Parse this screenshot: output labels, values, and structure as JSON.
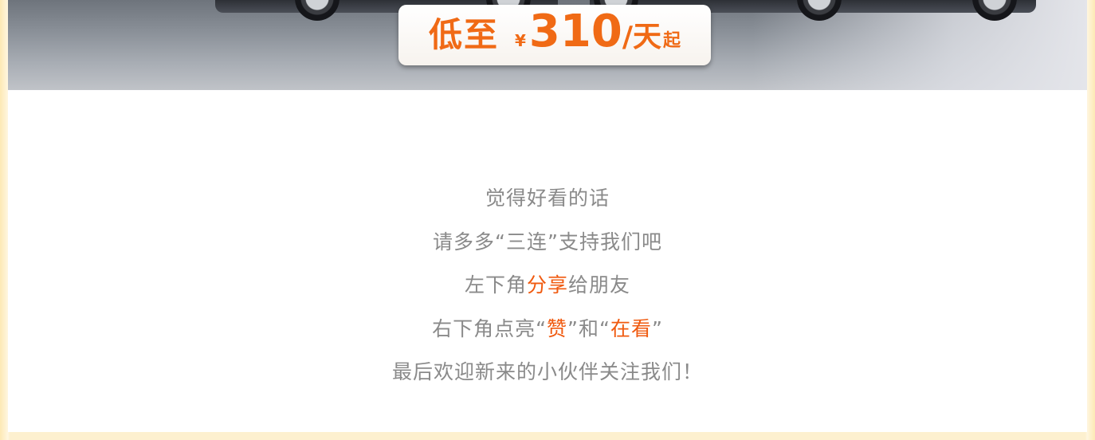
{
  "banner": {
    "price_prefix": "低至",
    "currency": "¥",
    "price": "310",
    "unit": "/天",
    "suffix": "起"
  },
  "message": {
    "line1": "觉得好看的话",
    "line2": "请多多“三连”支持我们吧",
    "line3": {
      "before": "左下角",
      "highlight": "分享",
      "after": "给朋友"
    },
    "line4": {
      "before": "右下角点亮“",
      "highlight1": "赞",
      "middle": "”和“",
      "highlight2": "在看",
      "after": "”"
    },
    "line5": "最后欢迎新来的小伙伴关注我们！"
  },
  "colors": {
    "highlight": "#f05a0f",
    "text": "#8a8a8a",
    "price": "#f06a15",
    "frame": "#fdf0cf"
  }
}
